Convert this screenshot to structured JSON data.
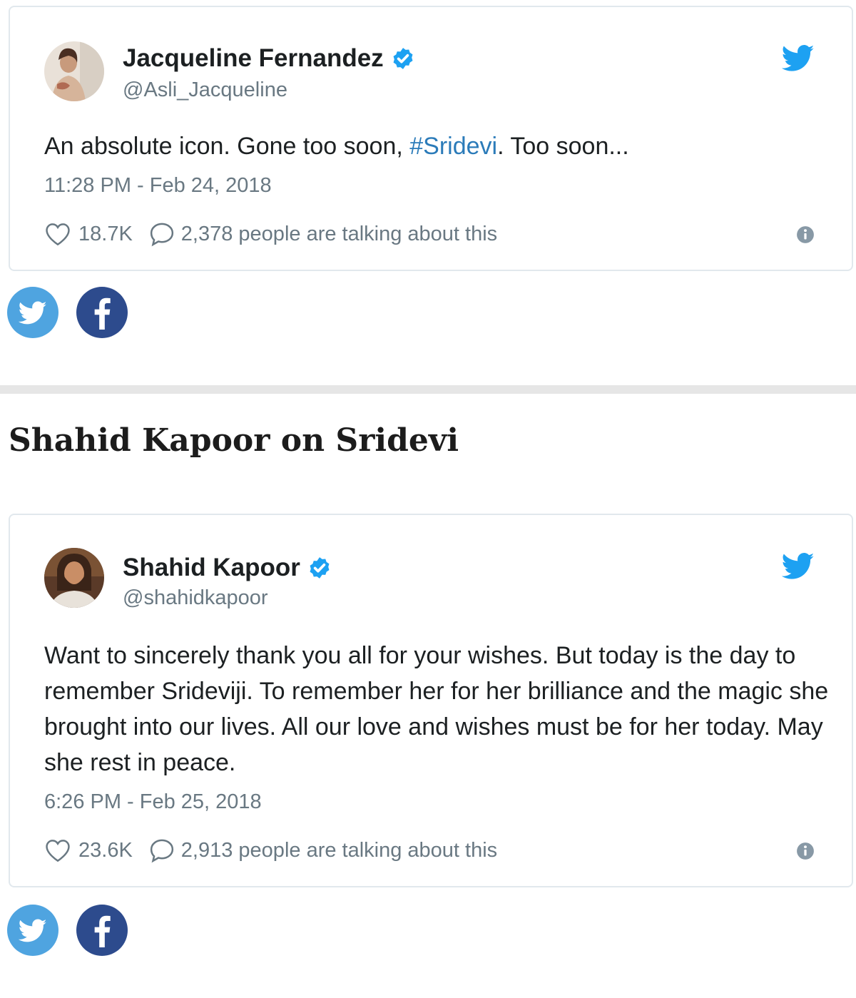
{
  "tweets": [
    {
      "author_name": "Jacqueline Fernandez",
      "author_handle": "@Asli_Jacqueline",
      "text_before": "An absolute icon. Gone too soon, ",
      "hashtag": "#Sridevi",
      "text_after": ". Too soon...",
      "timestamp": "11:28 PM - Feb 24, 2018",
      "likes": "18.7K",
      "talking": "2,378 people are talking about this"
    },
    {
      "author_name": "Shahid Kapoor",
      "author_handle": "@shahidkapoor",
      "text": "Want to sincerely thank you all for your wishes. But today is the day to remember Srideviji. To remember her for her brilliance and the magic she brought into our lives. All our love and wishes must be for her today. May she rest in peace.",
      "timestamp": "6:26 PM - Feb 25, 2018",
      "likes": "23.6K",
      "talking": "2,913 people are talking about this"
    }
  ],
  "section_heading": "Shahid Kapoor on Sridevi",
  "icons": [
    "verified-badge-icon",
    "twitter-bird-icon",
    "heart-icon",
    "reply-bubble-icon",
    "info-icon",
    "facebook-icon"
  ],
  "colors": {
    "twitter_blue": "#1da1f2",
    "hashtag": "#2b7bb9",
    "muted_text": "#697882",
    "facebook_blue": "#2d4b8d",
    "share_twitter": "#4fa4e0"
  }
}
